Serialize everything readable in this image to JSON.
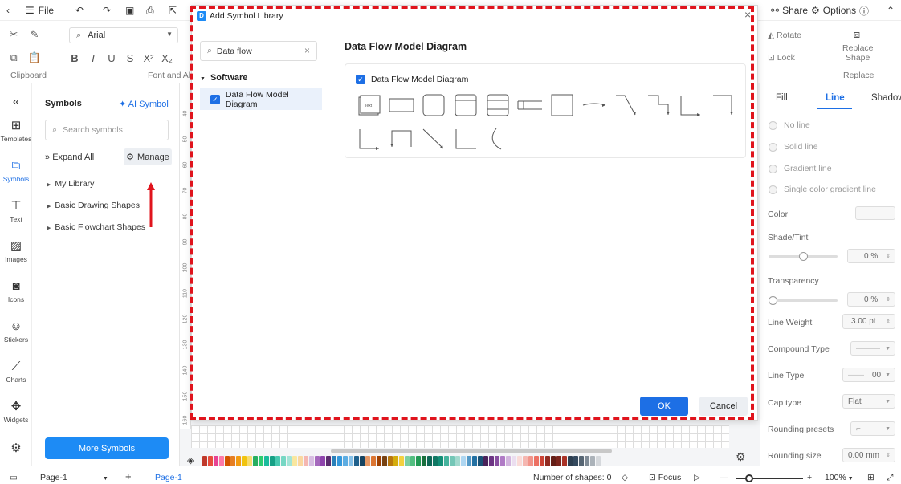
{
  "topbar": {
    "file_label": "File",
    "share_label": "Share",
    "options_label": "Options"
  },
  "ribbon": {
    "font_name": "Arial",
    "clipboard_label": "Clipboard",
    "font_label": "Font and Al",
    "rotate_label": "Rotate",
    "lock_label": "Lock",
    "replace_shape_label_1": "Replace",
    "replace_shape_label_2": "Shape",
    "replace_group_label": "Replace"
  },
  "rail": {
    "items": [
      {
        "label": "Templates",
        "icon": "templates-icon"
      },
      {
        "label": "Symbols",
        "icon": "symbols-icon"
      },
      {
        "label": "Text",
        "icon": "text-icon"
      },
      {
        "label": "Images",
        "icon": "images-icon"
      },
      {
        "label": "Icons",
        "icon": "icons-icon"
      },
      {
        "label": "Stickers",
        "icon": "stickers-icon"
      },
      {
        "label": "Charts",
        "icon": "charts-icon"
      },
      {
        "label": "Widgets",
        "icon": "widgets-icon"
      }
    ]
  },
  "symbols_panel": {
    "title": "Symbols",
    "ai_symbol": "AI Symbol",
    "search_placeholder": "Search symbols",
    "expand_all": "Expand All",
    "manage": "Manage",
    "libraries": [
      "My Library",
      "Basic Drawing Shapes",
      "Basic Flowchart Shapes"
    ],
    "more_symbols": "More Symbols"
  },
  "ruler_ticks": [
    "40",
    "50",
    "60",
    "70",
    "80",
    "90",
    "100",
    "110",
    "120",
    "130",
    "140",
    "150",
    "160"
  ],
  "dialog": {
    "title": "Add Symbol Library",
    "search_value": "Data flow",
    "category": "Software",
    "selected_item": "Data Flow Model Diagram",
    "heading": "Data Flow Model Diagram",
    "card_title": "Data Flow Model Diagram",
    "ok": "OK",
    "cancel": "Cancel"
  },
  "right_panel": {
    "tabs": [
      "Fill",
      "Line",
      "Shadow"
    ],
    "active_tab": "Line",
    "line_options": [
      "No line",
      "Solid line",
      "Gradient line",
      "Single color gradient line"
    ],
    "color_label": "Color",
    "shade_label": "Shade/Tint",
    "shade_value": "0 %",
    "shade_fraction": 0.5,
    "transparency_label": "Transparency",
    "transparency_value": "0 %",
    "transparency_fraction": 0.0,
    "line_weight_label": "Line Weight",
    "line_weight_value": "3.00 pt",
    "compound_type_label": "Compound Type",
    "line_type_label": "Line Type",
    "line_type_value": "00",
    "cap_type_label": "Cap type",
    "cap_type_value": "Flat",
    "rounding_presets_label": "Rounding presets",
    "rounding_size_label": "Rounding size",
    "rounding_size_value": "0.00 mm"
  },
  "statusbar": {
    "page_select": "Page-1",
    "page_tab": "Page-1",
    "shape_count": "Number of shapes: 0",
    "focus_label": "Focus",
    "zoom": "100%"
  },
  "colors": {
    "accent": "#1d6fe5",
    "highlight": "#e0141d"
  }
}
